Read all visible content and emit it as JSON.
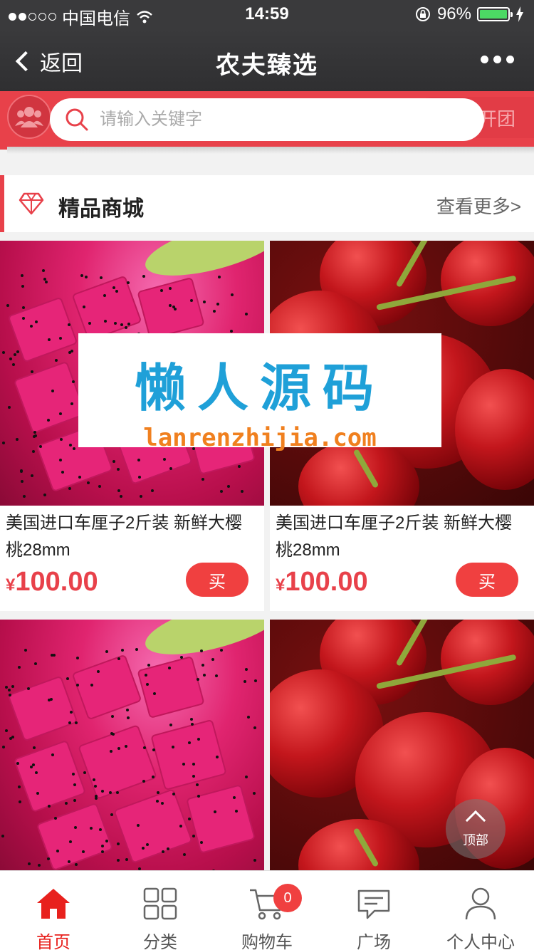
{
  "status_bar": {
    "carrier": "中国电信",
    "time": "14:59",
    "battery": "96%"
  },
  "nav": {
    "back_label": "返回",
    "title": "农夫臻选"
  },
  "search": {
    "placeholder": "请输入关键字",
    "kaituan_label": "开团"
  },
  "section": {
    "title": "精品商城",
    "more_label": "查看更多>"
  },
  "products": [
    {
      "name": "美国进口车厘子2斤装 新鲜大樱桃28mm",
      "currency": "¥",
      "price": "100.00",
      "buy_label": "买",
      "image": "dragon-fruit"
    },
    {
      "name": "美国进口车厘子2斤装 新鲜大樱桃28mm",
      "currency": "¥",
      "price": "100.00",
      "buy_label": "买",
      "image": "cherries"
    },
    {
      "name": "",
      "image": "dragon-fruit"
    },
    {
      "name": "",
      "image": "cherries"
    }
  ],
  "watermark": {
    "cn": "懒人源码",
    "en": "lanrenzhijia.com"
  },
  "to_top_label": "顶部",
  "tabbar": {
    "items": [
      {
        "label": "首页",
        "icon": "home-icon",
        "active": true
      },
      {
        "label": "分类",
        "icon": "grid-icon",
        "active": false
      },
      {
        "label": "购物车",
        "icon": "cart-icon",
        "active": false,
        "badge": "0"
      },
      {
        "label": "广场",
        "icon": "chat-icon",
        "active": false
      },
      {
        "label": "个人中心",
        "icon": "user-icon",
        "active": false
      }
    ]
  },
  "colors": {
    "accent": "#e8414a",
    "active_tab": "#e8211d",
    "watermark_blue": "#1fa0d8",
    "watermark_orange": "#f0801f"
  }
}
